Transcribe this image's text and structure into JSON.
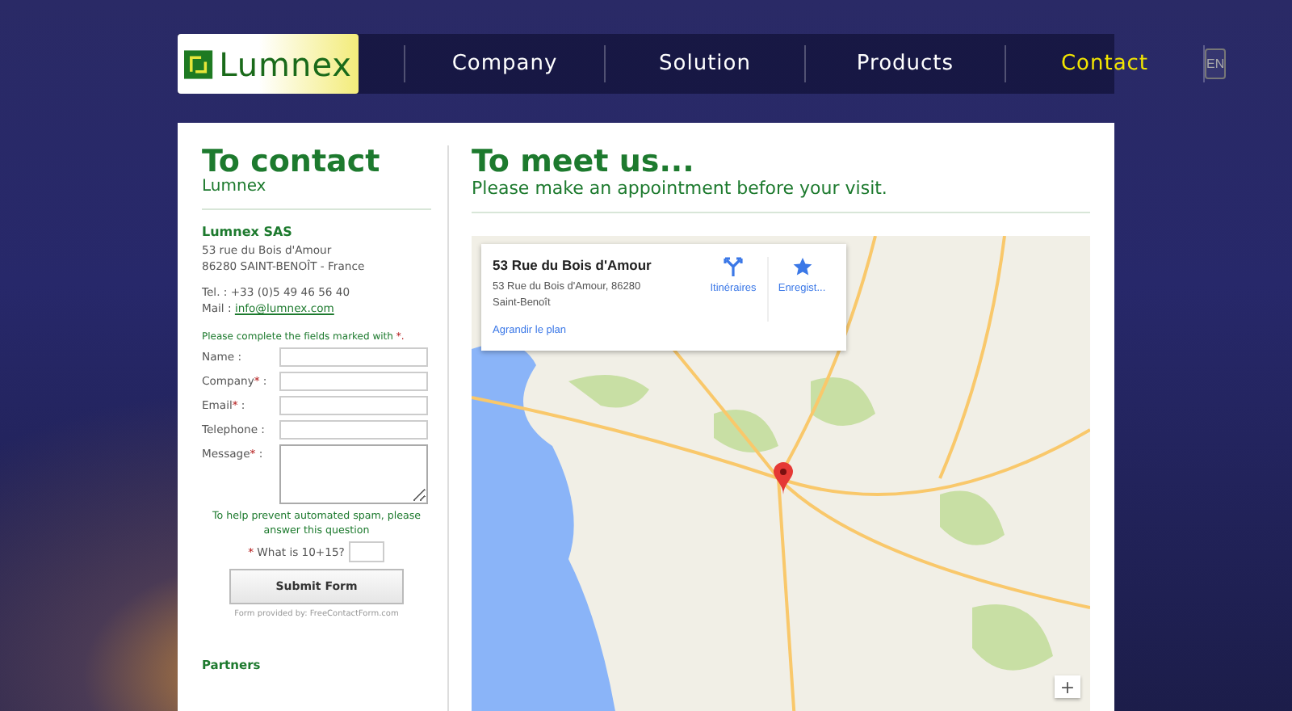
{
  "header": {
    "logo": "Lumnex",
    "nav": [
      {
        "label": "Company",
        "selected": false
      },
      {
        "label": "Solution",
        "selected": false
      },
      {
        "label": "Products",
        "selected": false
      },
      {
        "label": "Contact",
        "selected": true
      }
    ],
    "language": "EN"
  },
  "contact": {
    "title": "To contact",
    "subtitle": "Lumnex",
    "company": "Lumnex SAS",
    "address": [
      "53 rue du Bois d'Amour",
      "86280 SAINT-BENOÎT - France"
    ],
    "phone": "Tel. : +33 (0)5 49 46 56 40",
    "mail_label": "Mail :",
    "mail": "info@lumnex.com"
  },
  "form": {
    "intro_text": "Please complete the fields marked with",
    "intro_mark": "*.",
    "fields": [
      {
        "kind": "text",
        "label": "Name :"
      },
      {
        "kind": "text",
        "label": "Company",
        "mark": "*",
        "tail": " :"
      },
      {
        "kind": "text",
        "label": "Email",
        "mark": "*",
        "tail": " :"
      },
      {
        "kind": "text",
        "label": "Telephone :"
      },
      {
        "kind": "textarea",
        "label": "Message",
        "mark": "*",
        "tail": " :"
      }
    ],
    "spam_note": "To help prevent automated spam, please answer this question",
    "question_mark": "*",
    "question": "What is 10+15?",
    "submit": "Submit Form",
    "credit": "Form provided by: FreeContactForm.com"
  },
  "partners": "Partners",
  "meet": {
    "title": "To meet us...",
    "subtitle": "Please make an appointment before your visit.",
    "map_card": {
      "title": "53 Rue du Bois d'Amour",
      "address": [
        "53 Rue du Bois d'Amour, 86280",
        "Saint-Benoît"
      ],
      "actions": [
        {
          "kind": "directions",
          "label": "Itinéraires"
        },
        {
          "kind": "save",
          "label": "Enregist..."
        }
      ],
      "link": "Agrandir le plan"
    },
    "zoom_in": "+"
  }
}
